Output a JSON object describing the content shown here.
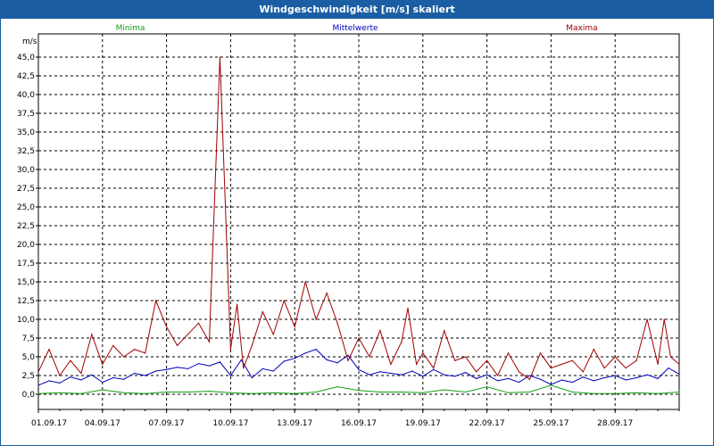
{
  "window": {
    "title": "Windgeschwindigkeit [m/s] skaliert"
  },
  "colors": {
    "titlebar": "#1b5ea3",
    "minima": "#12a012",
    "mittel": "#0000bb",
    "maxima": "#a00000",
    "grid": "#000000"
  },
  "chart_data": {
    "type": "line",
    "title": "Windgeschwindigkeit [m/s] skaliert",
    "ylabel": "m/s",
    "xlabel": "",
    "ylim": [
      0,
      45
    ],
    "y_ticks": [
      "0,0",
      "2,5",
      "5,0",
      "7,5",
      "10,0",
      "12,5",
      "15,0",
      "17,5",
      "20,0",
      "22,5",
      "25,0",
      "27,5",
      "30,0",
      "32,5",
      "35,0",
      "37,5",
      "40,0",
      "42,5",
      "45,0"
    ],
    "x_ticks": [
      "01.09.17",
      "04.09.17",
      "07.09.17",
      "10.09.17",
      "13.09.17",
      "16.09.17",
      "19.09.17",
      "22.09.17",
      "25.09.17",
      "28.09.17"
    ],
    "x_start_day": 1,
    "x_end_day": 31,
    "grid": true,
    "legend_position": "top",
    "series": [
      {
        "name": "Minima",
        "color": "#12a012",
        "x": [
          1,
          2,
          3,
          4,
          5,
          6,
          7,
          8,
          9,
          10,
          11,
          12,
          13,
          14,
          15,
          16,
          17,
          18,
          19,
          20,
          21,
          22,
          23,
          24,
          25,
          26,
          27,
          28,
          29,
          30,
          31
        ],
        "values": [
          0.1,
          0.2,
          0.1,
          0.6,
          0.2,
          0.1,
          0.3,
          0.3,
          0.4,
          0.2,
          0.1,
          0.2,
          0.1,
          0.3,
          1.0,
          0.5,
          0.3,
          0.3,
          0.2,
          0.6,
          0.3,
          1.0,
          0.2,
          0.3,
          1.2,
          0.3,
          0.1,
          0.1,
          0.2,
          0.1,
          0.3
        ]
      },
      {
        "name": "Mittelwerte",
        "color": "#0000bb",
        "x": [
          1,
          1.5,
          2,
          2.5,
          3,
          3.5,
          4,
          4.5,
          5,
          5.5,
          6,
          6.5,
          7,
          7.5,
          8,
          8.5,
          9,
          9.5,
          10,
          10.5,
          11,
          11.5,
          12,
          12.5,
          13,
          13.5,
          14,
          14.5,
          15,
          15.5,
          16,
          16.5,
          17,
          17.5,
          18,
          18.5,
          19,
          19.5,
          20,
          20.5,
          21,
          21.5,
          22,
          22.5,
          23,
          23.5,
          24,
          24.5,
          25,
          25.5,
          26,
          26.5,
          27,
          27.5,
          28,
          28.5,
          29,
          29.5,
          30,
          30.5,
          31
        ],
        "values": [
          1.2,
          1.8,
          1.5,
          2.3,
          1.9,
          2.6,
          1.6,
          2.2,
          2.0,
          2.8,
          2.5,
          3.1,
          3.3,
          3.6,
          3.4,
          4.1,
          3.8,
          4.3,
          2.5,
          4.6,
          2.2,
          3.4,
          3.1,
          4.4,
          4.8,
          5.5,
          6.0,
          4.6,
          4.2,
          5.2,
          3.3,
          2.6,
          3.0,
          2.8,
          2.6,
          3.1,
          2.4,
          3.3,
          2.6,
          2.4,
          2.9,
          2.1,
          2.6,
          1.8,
          2.1,
          1.6,
          2.5,
          2.0,
          1.3,
          1.9,
          1.6,
          2.3,
          1.8,
          2.2,
          2.5,
          1.9,
          2.2,
          2.6,
          2.1,
          3.5,
          2.7
        ]
      },
      {
        "name": "Maxima",
        "color": "#a00000",
        "x": [
          1,
          1.5,
          2,
          2.5,
          3,
          3.5,
          4,
          4.5,
          5,
          5.5,
          6,
          6.5,
          7,
          7.5,
          8,
          8.5,
          9,
          9.5,
          10,
          10.3,
          10.6,
          11,
          11.5,
          12,
          12.5,
          13,
          13.5,
          14,
          14.5,
          15,
          15.5,
          16,
          16.5,
          17,
          17.5,
          18,
          18.3,
          18.7,
          19,
          19.5,
          20,
          20.5,
          21,
          21.5,
          22,
          22.5,
          23,
          23.5,
          24,
          24.5,
          25,
          25.5,
          26,
          26.5,
          27,
          27.5,
          28,
          28.5,
          29,
          29.5,
          30,
          30.3,
          30.6,
          31
        ],
        "values": [
          3.0,
          6.0,
          2.5,
          4.5,
          2.8,
          8.0,
          4.0,
          6.5,
          5.0,
          6.0,
          5.5,
          12.5,
          9.0,
          6.5,
          8.0,
          9.5,
          7.0,
          45.0,
          6.0,
          12.0,
          3.5,
          6.5,
          11.0,
          8.0,
          12.5,
          9.0,
          15.0,
          10.0,
          13.5,
          9.5,
          4.5,
          7.5,
          5.0,
          8.5,
          4.0,
          7.0,
          11.5,
          4.0,
          5.5,
          3.5,
          8.5,
          4.5,
          5.0,
          3.0,
          4.5,
          2.5,
          5.5,
          3.0,
          2.0,
          5.5,
          3.5,
          4.0,
          4.5,
          3.0,
          6.0,
          3.5,
          5.0,
          3.5,
          4.5,
          10.0,
          4.0,
          10.0,
          5.0,
          4.0
        ]
      }
    ]
  }
}
